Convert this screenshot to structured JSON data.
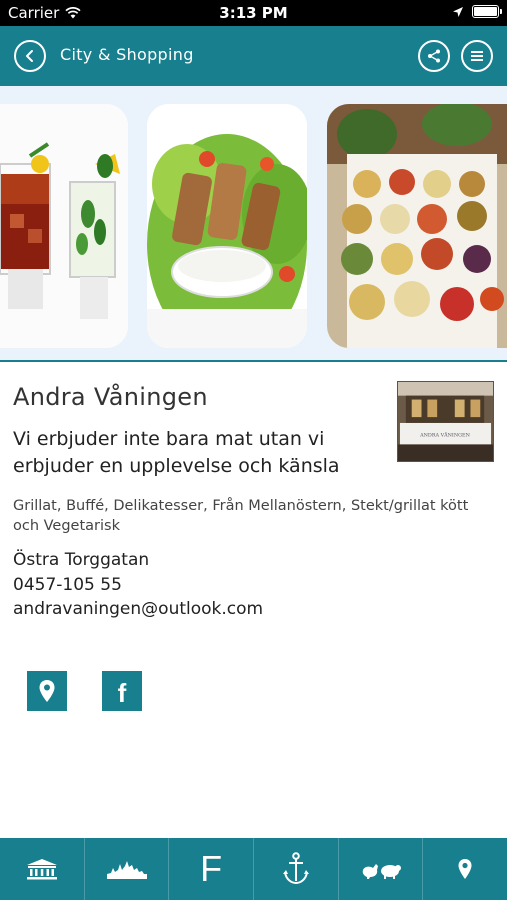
{
  "status_bar": {
    "carrier": "Carrier",
    "time": "3:13 PM"
  },
  "nav": {
    "title": "City & Shopping"
  },
  "gallery": {
    "images": [
      "cocktails",
      "grilled-chicken-salad",
      "buffet-table"
    ]
  },
  "place": {
    "name": "Andra Våningen",
    "tagline": "Vi erbjuder inte bara mat utan vi erbjuder en upplevelse och känsla",
    "categories": "Grillat, Buffé, Delikatesser, Från Mellanöstern, Stekt/grillat kött och Vegetarisk",
    "address": "Östra Torggatan",
    "phone": "0457-105 55",
    "email": "andravaningen@outlook.com",
    "thumbnail_sign": "ANDRA VÅNINGEN"
  },
  "social": {
    "facebook_glyph": "f"
  },
  "tabs": {
    "items": [
      "museum-icon",
      "skyline-icon",
      "F",
      "anchor-icon",
      "animals-icon",
      "map-pin-icon"
    ],
    "f_label": "F"
  },
  "colors": {
    "primary": "#177f8e",
    "gallery_bg": "#eaf3fb"
  }
}
